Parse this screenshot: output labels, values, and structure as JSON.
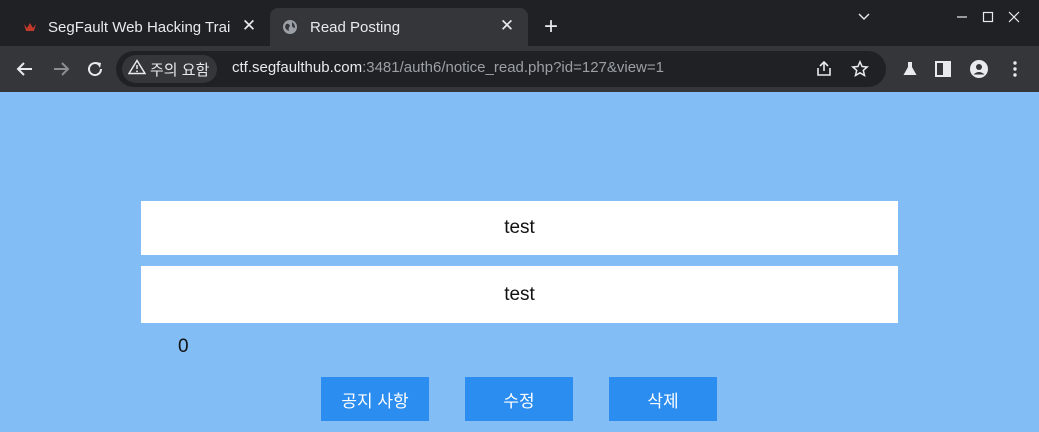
{
  "tabs": [
    {
      "title": "SegFault Web Hacking Trai",
      "favicon": "segfault-logo-icon",
      "active": false
    },
    {
      "title": "Read Posting",
      "favicon": "globe-icon",
      "active": true
    }
  ],
  "toolbar": {
    "security_label": "주의 요함",
    "url_host": "ctf.segfaulthub.com",
    "url_path": ":3481/auth6/notice_read.php?id=127&view=1"
  },
  "post": {
    "title": "test",
    "content": "test",
    "views": "0"
  },
  "buttons": {
    "list": "공지 사항",
    "edit": "수정",
    "delete": "삭제"
  },
  "colors": {
    "page_bg": "#83bdf6",
    "button_bg": "#2b8def",
    "chrome_dark": "#202124",
    "chrome_toolbar": "#35363a"
  }
}
